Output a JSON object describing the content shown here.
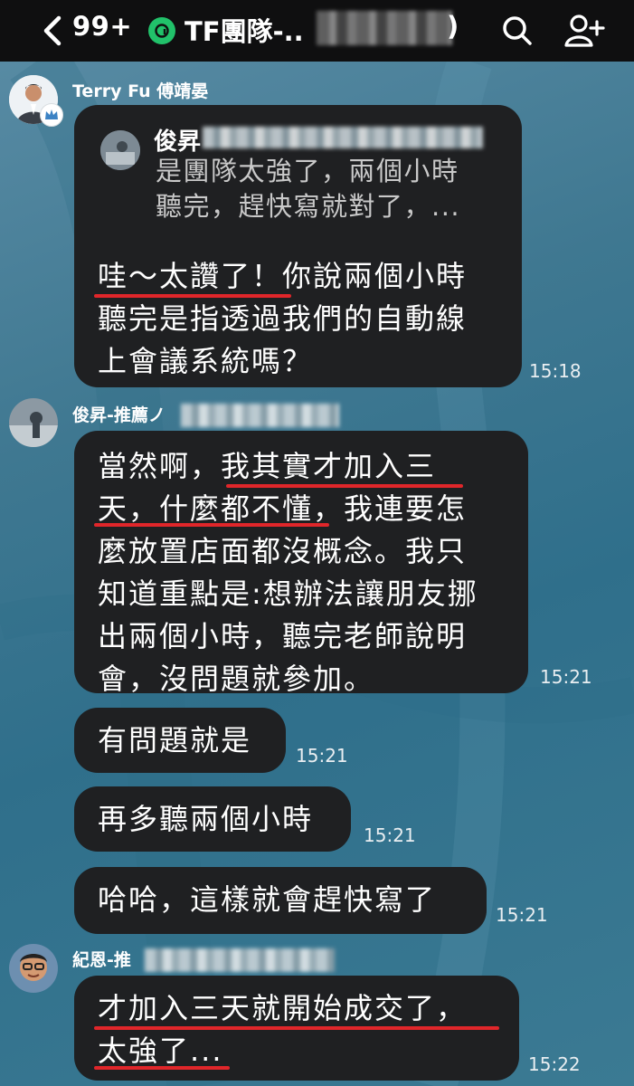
{
  "header": {
    "unread_count": "99+",
    "group_title": "TF團隊-..",
    "title_end": ")",
    "back_icon": "chevron-left-icon",
    "search_icon": "search-icon",
    "add_friend_icon": "add-friend-icon"
  },
  "messages": [
    {
      "sender": "Terry Fu 傅靖晏",
      "reply": {
        "name": "俊昇",
        "text": "是團隊太強了，兩個小時\n聽完，趕快寫就對了，..."
      },
      "text": "哇～太讚了！你說兩個小時\n聽完是指透過我們的自動線\n上會議系統嗎？",
      "time": "15:18"
    },
    {
      "sender": "俊昇-推薦ノ",
      "text": "當然啊，我其實才加入三\n天，什麼都不懂，我連要怎\n麼放置店面都沒概念。我只\n知道重點是:想辦法讓朋友挪\n出兩個小時，聽完老師說明\n會，沒問題就參加。",
      "time": "15:21"
    },
    {
      "text": "有問題就是",
      "time": "15:21"
    },
    {
      "text": "再多聽兩個小時",
      "time": "15:21"
    },
    {
      "text": "哈哈，這樣就會趕快寫了",
      "time": "15:21"
    },
    {
      "sender": "紀恩-推",
      "text": "才加入三天就開始成交了，\n太強了...",
      "time": "15:22"
    }
  ],
  "colors": {
    "header_bg": "#0f0f10",
    "bubble_bg": "#1f2022",
    "underline": "#e0262a",
    "group_icon": "#21c16a"
  }
}
